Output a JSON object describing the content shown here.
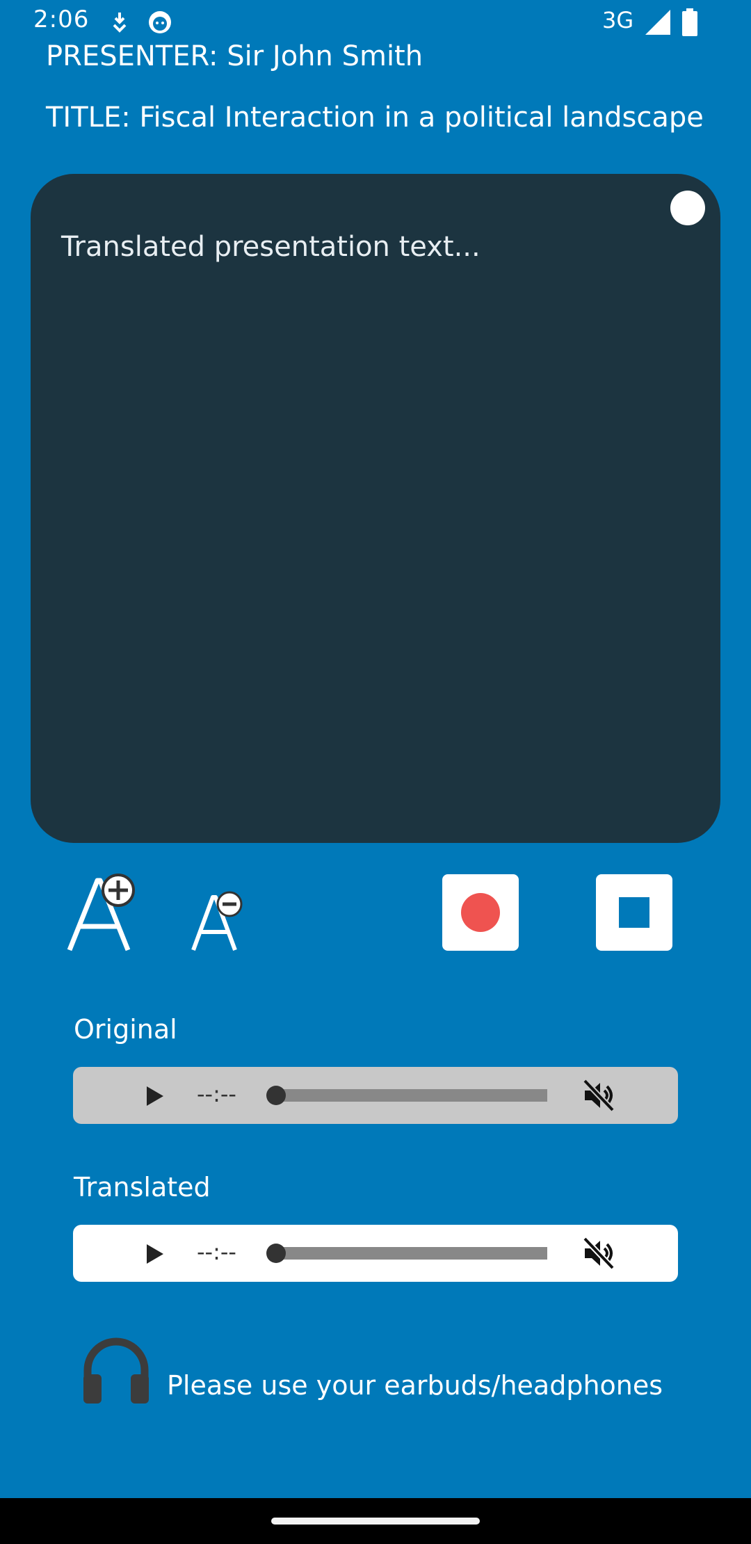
{
  "status_bar": {
    "time": "2:06",
    "network": "3G",
    "icons": [
      "download-icon",
      "cat-face-icon",
      "signal-icon",
      "battery-icon"
    ]
  },
  "header": {
    "presenter": "PRESENTER: Sir John Smith",
    "title": "TITLE: Fiscal Interaction in a political landscape"
  },
  "panel": {
    "text": "Translated presentation text..."
  },
  "controls": {
    "font_increase_icon": "font-size-increase-icon",
    "font_decrease_icon": "font-size-decrease-icon",
    "record_icon": "record-icon",
    "stop_icon": "stop-icon",
    "record_color": "#ef5350"
  },
  "audio": {
    "original": {
      "label": "Original",
      "time": "--:--"
    },
    "translated": {
      "label": "Translated",
      "time": "--:--"
    }
  },
  "note": {
    "text": "Please use your earbuds/headphones",
    "icon": "headphones-icon"
  },
  "colors": {
    "background": "#0079b9",
    "panel": "#1c3440",
    "record": "#ef5350"
  }
}
